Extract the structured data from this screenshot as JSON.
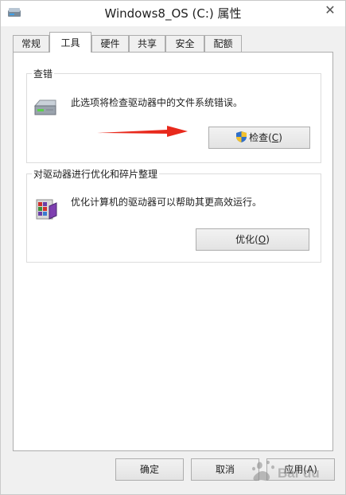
{
  "window": {
    "title": "Windows8_OS (C:) 属性",
    "close_glyph": "✕"
  },
  "tabs": [
    {
      "label": "常规",
      "active": false
    },
    {
      "label": "工具",
      "active": true
    },
    {
      "label": "硬件",
      "active": false
    },
    {
      "label": "共享",
      "active": false
    },
    {
      "label": "安全",
      "active": false
    },
    {
      "label": "配额",
      "active": false
    }
  ],
  "error_check": {
    "group_label": "查错",
    "description": "此选项将检查驱动器中的文件系统错误。",
    "button_text": "检查(",
    "button_hotkey": "C",
    "button_suffix": ")",
    "icon": "drive-icon",
    "annotation_color": "#e8291c"
  },
  "optimize": {
    "group_label": "对驱动器进行优化和碎片整理",
    "description": "优化计算机的驱动器可以帮助其更高效运行。",
    "button_text": "优化(",
    "button_hotkey": "O",
    "button_suffix": ")",
    "icon": "defrag-icon"
  },
  "footer": {
    "ok_label": "确定",
    "cancel_label": "取消",
    "apply_label": "应用(A)"
  }
}
